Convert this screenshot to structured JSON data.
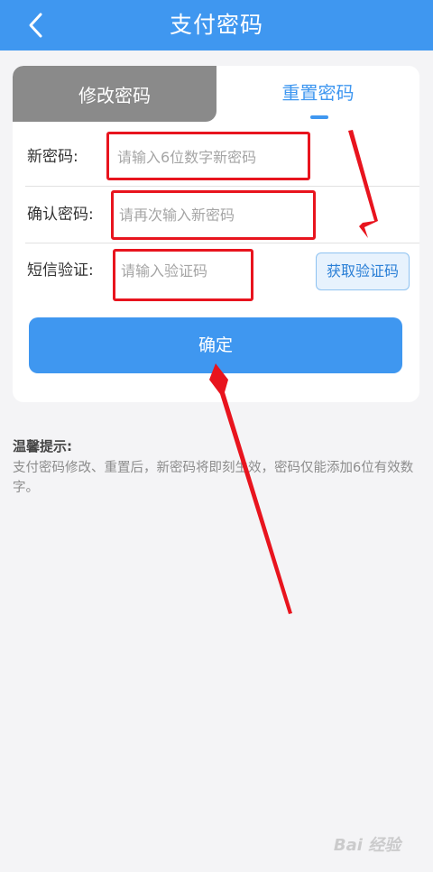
{
  "header": {
    "title": "支付密码",
    "back_icon": "chevron-left-icon"
  },
  "tabs": [
    {
      "label": "修改密码",
      "active": false
    },
    {
      "label": "重置密码",
      "active": true
    }
  ],
  "form": {
    "new_password": {
      "label": "新密码:",
      "placeholder": "请输入6位数字新密码"
    },
    "confirm_password": {
      "label": "确认密码:",
      "placeholder": "请再次输入新密码"
    },
    "sms_code": {
      "label": "短信验证:",
      "placeholder": "请输入验证码",
      "button_label": "获取验证码"
    },
    "submit_label": "确定"
  },
  "tips": {
    "title": "温馨提示:",
    "text": "支付密码修改、重置后，新密码将即刻生效，密码仅能添加6位有效数字。"
  },
  "watermark": {
    "text": "Bai 经验"
  },
  "colors": {
    "primary": "#3f97f0",
    "highlight": "#e8141e",
    "tab_inactive": "#8a8a8a"
  }
}
